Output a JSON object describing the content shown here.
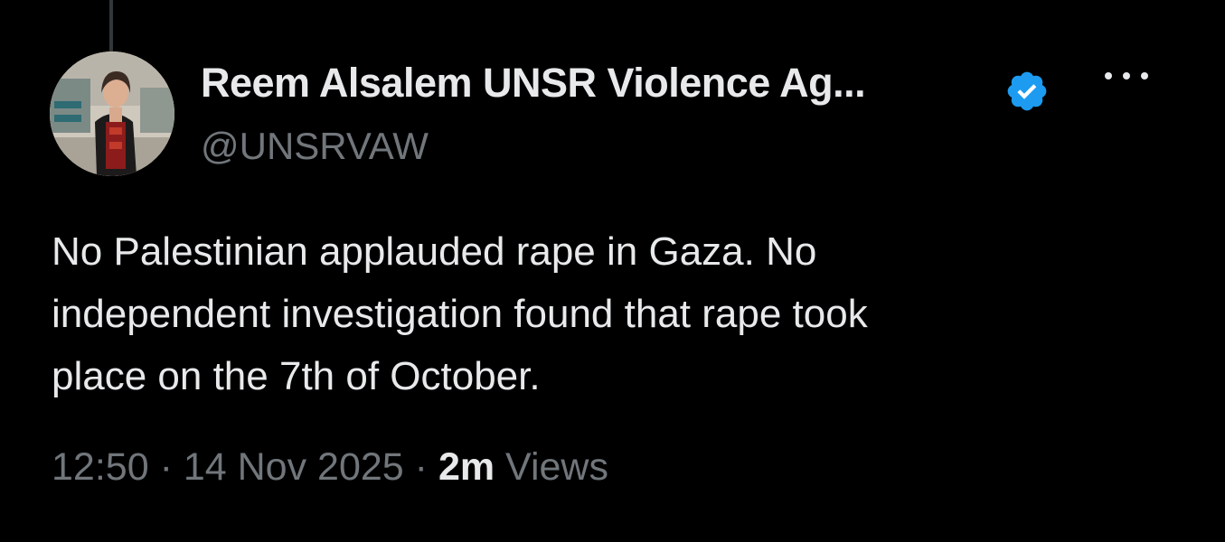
{
  "author": {
    "display_name": "Reem Alsalem UNSR Violence Ag...",
    "handle": "@UNSRVAW",
    "verified": true,
    "verified_color": "#1d9bf0"
  },
  "tweet": {
    "lines": [
      "No Palestinian applauded rape in Gaza. No",
      "independent investigation found that rape took",
      "place on the 7th of October."
    ]
  },
  "meta": {
    "time": "12:50",
    "separator": "·",
    "date": "14 Nov 2025",
    "views_count": "2m",
    "views_label": "Views"
  },
  "icons": {
    "verified": "verified-badge-icon",
    "more": "more-options-icon"
  },
  "colors": {
    "background": "#000000",
    "primary_text": "#e7e9ea",
    "secondary_text": "#71767b"
  }
}
